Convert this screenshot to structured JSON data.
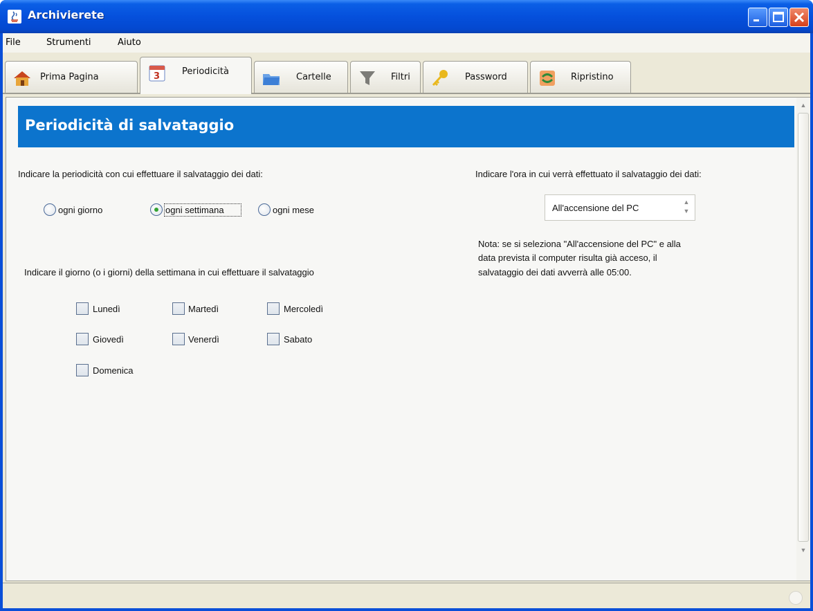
{
  "window": {
    "title": "Archivierete"
  },
  "menu": [
    "File",
    "Strumenti",
    "Aiuto"
  ],
  "tabs": [
    {
      "label": "Prima Pagina",
      "icon": "home-icon"
    },
    {
      "label": "Periodicità",
      "icon": "calendar-icon"
    },
    {
      "label": "Cartelle",
      "icon": "folder-icon"
    },
    {
      "label": "Filtri",
      "icon": "filter-icon"
    },
    {
      "label": "Password",
      "icon": "key-icon"
    },
    {
      "label": "Ripristino",
      "icon": "restore-icon"
    }
  ],
  "active_tab": "Periodicità",
  "panel": {
    "title": "Periodicità di salvataggio",
    "periodicity_prompt": "Indicare la periodicità con cui effettuare il salvataggio dei dati:",
    "periodicity_options": [
      "ogni giorno",
      "ogni settimana",
      "ogni mese"
    ],
    "periodicity_selected": "ogni settimana",
    "days_prompt": "Indicare il giorno (o i giorni) della settimana in cui effettuare il salvataggio",
    "days": [
      "Lunedì",
      "Martedì",
      "Mercoledì",
      "Giovedì",
      "Venerdì",
      "Sabato",
      "Domenica"
    ],
    "time_prompt": "Indicare l'ora in cui verrà effettuato il salvataggio dei dati:",
    "time_value": "All'accensione del PC",
    "note": [
      "Nota: se si seleziona \"All'accensione del PC\" e alla",
      "data prevista il computer risulta già acceso, il",
      "salvataggio dei dati avverrà alle 05:00."
    ]
  },
  "colors": {
    "header_band": "#0c74cd",
    "title_bar": "#0550dc",
    "radio_dot": "#34a234"
  }
}
